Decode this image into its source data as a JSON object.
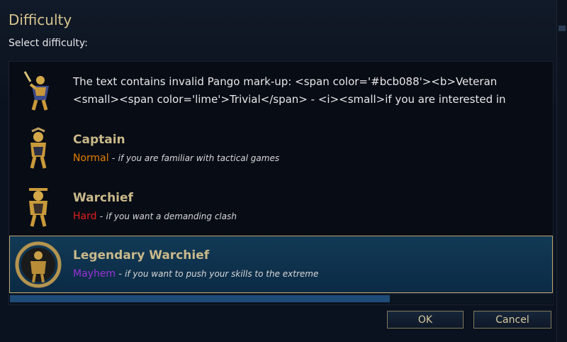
{
  "dialog": {
    "title": "Difficulty",
    "subtitle": "Select difficulty:"
  },
  "rows": [
    {
      "error_line1": "The text contains invalid Pango mark-up: <span color='#bcb088'><b>Veteran",
      "error_line2": "<small><span color='lime'>Trivial</span> - <i><small>if you are interested in",
      "sprite_icon": "swordsman-sprite-icon"
    },
    {
      "name": "Captain",
      "level": "Normal",
      "level_color": "#e67e00",
      "separator": "-",
      "hint": "if you are familiar with tactical games",
      "sprite_icon": "captain-sprite-icon"
    },
    {
      "name": "Warchief",
      "level": "Hard",
      "level_color": "#e02020",
      "separator": "-",
      "hint": "if you want a demanding clash",
      "sprite_icon": "warchief-sprite-icon"
    },
    {
      "name": "Legendary Warchief",
      "level": "Mayhem",
      "level_color": "#9b30d9",
      "separator": "-",
      "hint": "if you want to push your skills to the extreme",
      "sprite_icon": "legendary-warchief-laurel-icon",
      "selected": true
    }
  ],
  "buttons": {
    "ok": "OK",
    "cancel": "Cancel"
  },
  "colors": {
    "accent_gold": "#bca46a",
    "selected_row": "#123a56"
  },
  "scrollbar": {
    "horizontal_visible_fraction": 0.7
  }
}
